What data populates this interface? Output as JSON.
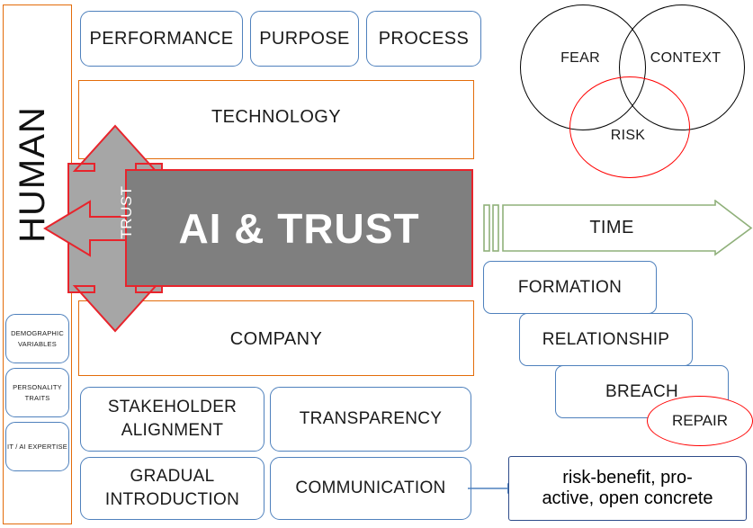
{
  "diagram": {
    "title": "AI & TRUST framework diagram",
    "center": {
      "label": "AI & TRUST",
      "fill": "#7F7F7F",
      "border": "#E8242C",
      "text_color": "#FFFFFF"
    },
    "trust_arrow": {
      "label": "TRUST",
      "fill": "#A6A6A6",
      "outline": "#E8242C"
    },
    "human_panel": {
      "label": "HUMAN",
      "border": "#E36C0A",
      "attributes": [
        {
          "label": "DEMOGRAPHIC VARIABLES"
        },
        {
          "label": "PERSONALITY TRAITS"
        },
        {
          "label": "IT / AI EXPERTISE"
        }
      ]
    },
    "technology": {
      "label": "TECHNOLOGY",
      "border": "#E36C0A",
      "factors": [
        {
          "label": "PERFORMANCE"
        },
        {
          "label": "PURPOSE"
        },
        {
          "label": "PROCESS"
        }
      ]
    },
    "company": {
      "label": "COMPANY",
      "border": "#E36C0A",
      "factors": [
        {
          "label": "STAKEHOLDER ALIGNMENT"
        },
        {
          "label": "TRANSPARENCY"
        },
        {
          "label": "GRADUAL INTRODUCTION"
        },
        {
          "label": "COMMUNICATION"
        }
      ]
    },
    "venn": {
      "circles": [
        {
          "label": "FEAR",
          "color": "#000000"
        },
        {
          "label": "CONTEXT",
          "color": "#000000"
        },
        {
          "label": "RISK",
          "color": "#FF0000"
        }
      ]
    },
    "time_arrow": {
      "label": "TIME",
      "color": "#8FB07A"
    },
    "stages": [
      {
        "label": "FORMATION"
      },
      {
        "label": "RELATIONSHIP"
      },
      {
        "label": "BREACH"
      }
    ],
    "repair": {
      "label": "REPAIR",
      "color": "#FF0000"
    },
    "communication_note": {
      "line1": "risk-benefit, pro-",
      "line2": "active, open concrete",
      "border": "#2E4C8A"
    }
  }
}
